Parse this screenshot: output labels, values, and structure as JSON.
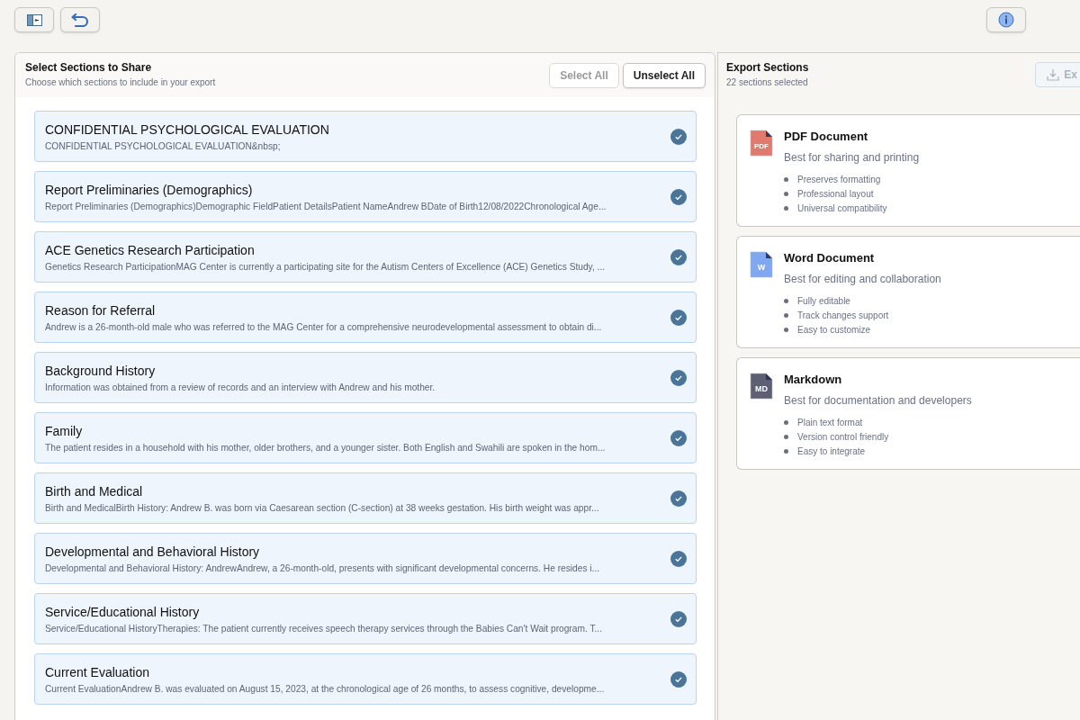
{
  "toolbar": {
    "left_buttons": [
      {
        "kind": "sidebar"
      },
      {
        "kind": "undo"
      }
    ],
    "right_buttons": [
      {
        "kind": "info"
      }
    ]
  },
  "sections_panel": {
    "title": "Select Sections to Share",
    "subtitle": "Choose which sections to include in your export",
    "buttons": [
      {
        "label": "Select All",
        "disabled": true
      },
      {
        "label": "Unselect All",
        "disabled": false
      }
    ],
    "sections": [
      {
        "title": "CONFIDENTIAL PSYCHOLOGICAL EVALUATION",
        "preview": "CONFIDENTIAL PSYCHOLOGICAL EVALUATION&nbsp;",
        "checked": true
      },
      {
        "title": "Report Preliminaries (Demographics)",
        "preview": "Report Preliminaries (Demographics)Demographic FieldPatient DetailsPatient NameAndrew BDate of Birth12/08/2022Chronological Age...",
        "checked": true
      },
      {
        "title": "ACE Genetics Research Participation",
        "preview": "Genetics Research ParticipationMAG Center is currently a participating site for the Autism Centers of Excellence (ACE) Genetics Study, ...",
        "checked": true
      },
      {
        "title": "Reason for Referral",
        "preview": "Andrew is a 26-month-old male who was referred to the MAG Center for a comprehensive neurodevelopmental assessment to obtain di...",
        "checked": true
      },
      {
        "title": "Background History",
        "preview": "Information was obtained from a review of records and an interview with Andrew and his mother.",
        "checked": true
      },
      {
        "title": "Family",
        "preview": "The patient resides in a household with his mother, older brothers, and a younger sister. Both English and Swahili are spoken in the hom...",
        "checked": true
      },
      {
        "title": "Birth and Medical",
        "preview": "Birth and MedicalBirth History: Andrew B. was born via Caesarean section (C-section) at 38 weeks gestation. His birth weight was appr...",
        "checked": true
      },
      {
        "title": "Developmental and Behavioral History",
        "preview": "Developmental and Behavioral History: AndrewAndrew, a 26-month-old, presents with significant developmental concerns. He resides i...",
        "checked": true
      },
      {
        "title": "Service/Educational History",
        "preview": "Service/Educational HistoryTherapies: The patient currently receives speech therapy services through the Babies Can't Wait program. T...",
        "checked": true
      },
      {
        "title": "Current Evaluation",
        "preview": "Current EvaluationAndrew B. was evaluated on August 15, 2023, at the chronological age of 26 months, to assess cognitive, developme...",
        "checked": true
      }
    ]
  },
  "export_panel": {
    "title": "Export Sections",
    "subtitle": "22 sections selected",
    "export_button": {
      "label": "Ex",
      "disabled": true
    },
    "formats": [
      {
        "kind": "pdf",
        "icon_label": "PDF",
        "title": "PDF Document",
        "description": "Best for sharing and printing",
        "features": [
          "Preserves formatting",
          "Professional layout",
          "Universal compatibility"
        ]
      },
      {
        "kind": "word",
        "icon_label": "W",
        "title": "Word Document",
        "description": "Best for editing and collaboration",
        "features": [
          "Fully editable",
          "Track changes support",
          "Easy to customize"
        ]
      },
      {
        "kind": "markdown",
        "icon_label": "MD",
        "title": "Markdown",
        "description": "Best for documentation and developers",
        "features": [
          "Plain text format",
          "Version control friendly",
          "Easy to integrate"
        ]
      }
    ]
  }
}
